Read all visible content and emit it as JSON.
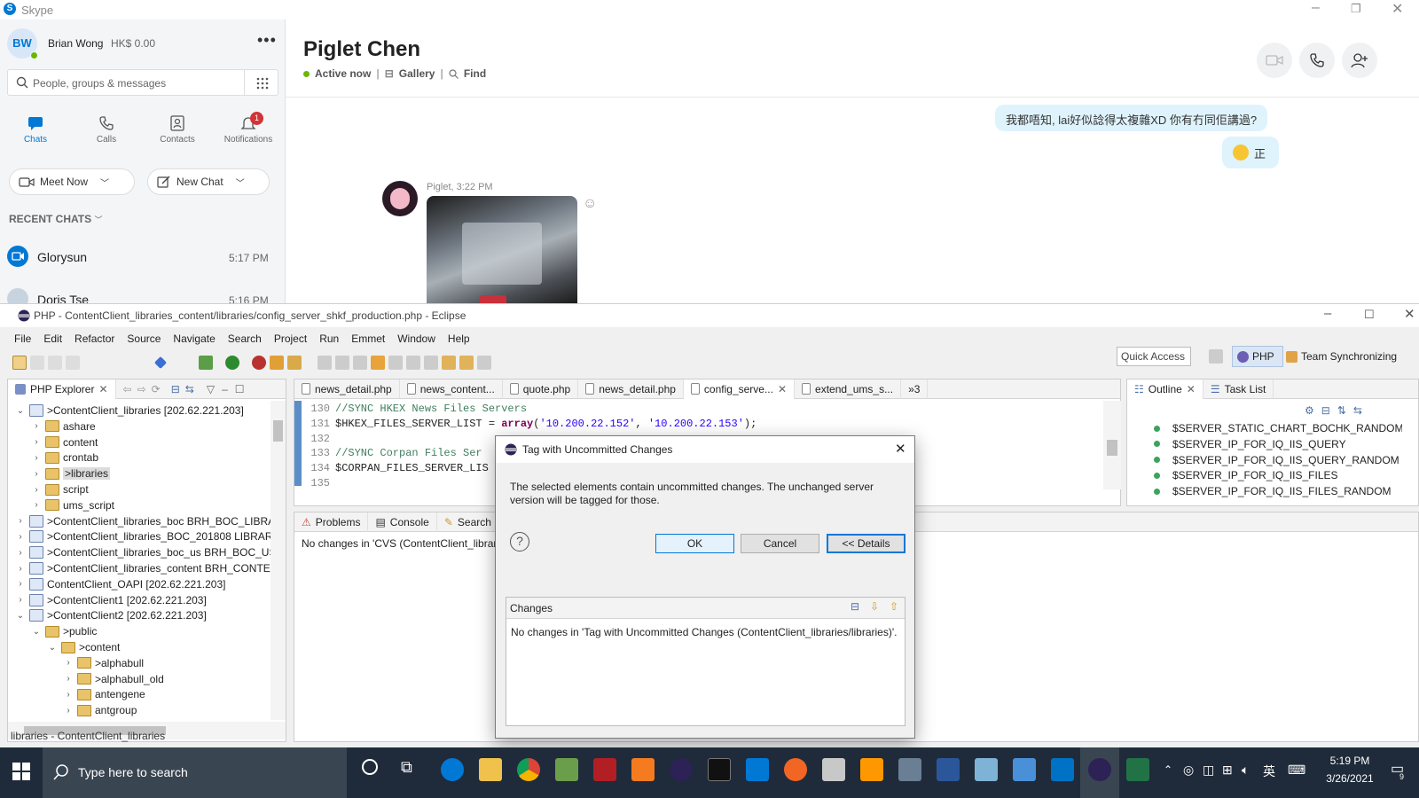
{
  "skype": {
    "app_title": "Skype",
    "user": {
      "initials": "BW",
      "name": "Brian Wong",
      "credit": "HK$ 0.00"
    },
    "search_placeholder": "People, groups & messages",
    "nav": [
      {
        "label": "Chats",
        "icon": "chat-icon"
      },
      {
        "label": "Calls",
        "icon": "phone-icon"
      },
      {
        "label": "Contacts",
        "icon": "contacts-icon"
      },
      {
        "label": "Notifications",
        "icon": "bell-icon",
        "badge": "1"
      }
    ],
    "meet_now": "Meet Now",
    "new_chat": "New Chat",
    "recent_label": "RECENT CHATS",
    "recent": [
      {
        "name": "Glorysun",
        "time": "5:17 PM"
      },
      {
        "name": "Doris Tse",
        "time": "5:16 PM"
      }
    ],
    "contact": {
      "name": "Piglet Chen",
      "status": "Active now",
      "gallery": "Gallery",
      "find": "Find"
    },
    "messages": {
      "out1": "我都唔知, lai好似諗得太複雜XD 你有冇同佢講過?",
      "out2": "正",
      "sender_meta": "Piglet, 3:22 PM"
    }
  },
  "eclipse": {
    "title": "PHP - ContentClient_libraries_content/libraries/config_server_shkf_production.php - Eclipse",
    "menu": [
      "File",
      "Edit",
      "Refactor",
      "Source",
      "Navigate",
      "Search",
      "Project",
      "Run",
      "Emmet",
      "Window",
      "Help"
    ],
    "quick_access": "Quick Access",
    "perspectives": [
      "PHP",
      "Team Synchronizing"
    ],
    "explorer_title": "PHP Explorer",
    "tree": [
      {
        "label": ">ContentClient_libraries   [202.62.221.203]",
        "level": 0,
        "open": true,
        "kind": "proj"
      },
      {
        "label": "ashare",
        "level": 1,
        "open": false,
        "kind": "fold"
      },
      {
        "label": "content",
        "level": 1,
        "open": false,
        "kind": "fold"
      },
      {
        "label": "crontab",
        "level": 1,
        "open": false,
        "kind": "fold"
      },
      {
        "label": ">libraries",
        "level": 1,
        "open": false,
        "kind": "fold",
        "selected": true
      },
      {
        "label": "script",
        "level": 1,
        "open": false,
        "kind": "fold"
      },
      {
        "label": "ums_script",
        "level": 1,
        "open": false,
        "kind": "fold"
      },
      {
        "label": ">ContentClient_libraries_boc  BRH_BOC_LIBRAR",
        "level": 0,
        "open": false,
        "kind": "proj"
      },
      {
        "label": ">ContentClient_libraries_BOC_201808  LIBRARIES",
        "level": 0,
        "open": false,
        "kind": "proj"
      },
      {
        "label": ">ContentClient_libraries_boc_us  BRH_BOC_US_",
        "level": 0,
        "open": false,
        "kind": "proj"
      },
      {
        "label": ">ContentClient_libraries_content  BRH_CONTEN",
        "level": 0,
        "open": false,
        "kind": "proj"
      },
      {
        "label": "ContentClient_OAPI   [202.62.221.203]",
        "level": 0,
        "open": false,
        "kind": "proj"
      },
      {
        "label": ">ContentClient1   [202.62.221.203]",
        "level": 0,
        "open": false,
        "kind": "proj"
      },
      {
        "label": ">ContentClient2   [202.62.221.203]",
        "level": 0,
        "open": true,
        "kind": "proj"
      },
      {
        "label": ">public",
        "level": 1,
        "open": true,
        "kind": "fold"
      },
      {
        "label": ">content",
        "level": 2,
        "open": true,
        "kind": "fold"
      },
      {
        "label": ">alphabull",
        "level": 3,
        "open": false,
        "kind": "fold"
      },
      {
        "label": ">alphabull_old",
        "level": 3,
        "open": false,
        "kind": "fold"
      },
      {
        "label": "antengene",
        "level": 3,
        "open": false,
        "kind": "fold"
      },
      {
        "label": "antgroup",
        "level": 3,
        "open": false,
        "kind": "fold"
      }
    ],
    "editor_tabs": [
      {
        "label": "news_detail.php",
        "active": false
      },
      {
        "label": "news_content...",
        "active": false
      },
      {
        "label": "quote.php",
        "active": false
      },
      {
        "label": "news_detail.php",
        "active": false
      },
      {
        "label": "config_serve...",
        "active": true
      },
      {
        "label": "extend_ums_s...",
        "active": false
      },
      {
        "label": "»3",
        "active": false
      }
    ],
    "code": [
      {
        "n": "130",
        "t": "//SYNC HKEX News Files Servers",
        "cls": "cm"
      },
      {
        "n": "131",
        "pre": "$HKEX_FILES_SERVER_LIST = ",
        "kw": "array",
        "rest1": "(",
        "s1": "'10.200.22.152'",
        "rest2": ", ",
        "s2": "'10.200.22.153'",
        "rest3": ");"
      },
      {
        "n": "132",
        "t": ""
      },
      {
        "n": "133",
        "t": "//SYNC Corpan Files Ser",
        "cls": "cm"
      },
      {
        "n": "134",
        "t": "$CORPAN_FILES_SERVER_LIS",
        "cls": ""
      },
      {
        "n": "135",
        "t": ""
      }
    ],
    "outline_tabs": [
      "Outline",
      "Task List"
    ],
    "outline_items": [
      "$SERVER_STATIC_CHART_BOCHK_RANDOM",
      "$SERVER_IP_FOR_IQ_IIS_QUERY",
      "$SERVER_IP_FOR_IQ_IIS_QUERY_RANDOM",
      "$SERVER_IP_FOR_IQ_IIS_FILES",
      "$SERVER_IP_FOR_IQ_IIS_FILES_RANDOM"
    ],
    "bottom_tabs": [
      "Problems",
      "Console",
      "Search"
    ],
    "console_text": "No changes in 'CVS (ContentClient_libraries",
    "status_bar": "libraries - ContentClient_libraries"
  },
  "dialog": {
    "title": "Tag with Uncommitted Changes",
    "message": "The selected elements contain uncommitted changes. The unchanged server version will be tagged for those.",
    "ok": "OK",
    "cancel": "Cancel",
    "details": "<< Details",
    "changes_label": "Changes",
    "changes_text": "No changes in 'Tag with Uncommitted Changes (ContentClient_libraries/libraries)'."
  },
  "taskbar": {
    "search_placeholder": "Type here to search",
    "time": "5:19 PM",
    "date": "3/26/2021",
    "ime": "英",
    "notif_count": "9"
  },
  "colors": {
    "skype_blue": "#0078d4",
    "taskbar": "#1f2b3a",
    "dialog_bg": "#f0f0f0"
  }
}
